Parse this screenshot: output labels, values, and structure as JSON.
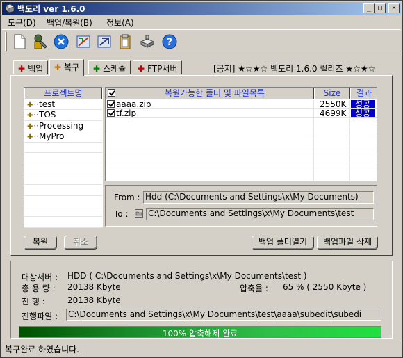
{
  "window": {
    "title": "백도리 ver 1.6.0"
  },
  "titlebar_buttons": {
    "minimize": "_",
    "maximize": "□",
    "close": "×"
  },
  "menu": [
    {
      "label": "도구(D)"
    },
    {
      "label": "백업/복원(B)"
    },
    {
      "label": "정보(A)"
    }
  ],
  "toolbar": {
    "icons": [
      "new-document-icon",
      "settings-wrench-icon",
      "stop-icon",
      "backup-run-icon",
      "restore-icon",
      "clipboard-icon",
      "network-drive-icon",
      "help-icon"
    ]
  },
  "tabs": [
    {
      "label": "백업",
      "dot": "✚",
      "dot_color": "#c00000"
    },
    {
      "label": "복구",
      "dot": "✚",
      "dot_color": "#c07000"
    },
    {
      "label": "스케쥴",
      "dot": "✚",
      "dot_color": "#008000"
    },
    {
      "label": "FTP서버",
      "dot": "✚",
      "dot_color": "#c00000"
    }
  ],
  "notice": "[공지]  ★☆★☆ 백도리 1.6.0 릴리즈 ★☆★☆",
  "project_list": {
    "header": "프로젝트명",
    "items": [
      "test",
      "TOS",
      "Processing",
      "MyPro"
    ]
  },
  "file_table": {
    "headers": {
      "name": "복원가능한 폴더 및 파일목록",
      "size": "Size",
      "result": "결과"
    },
    "rows": [
      {
        "name": "aaaa.zip",
        "size": "2550K",
        "result": "성공"
      },
      {
        "name": "tf.zip",
        "size": "4699K",
        "result": "성공"
      }
    ]
  },
  "from_to": {
    "from_label": "From :",
    "from_value": "Hdd (C:\\Documents and Settings\\x\\My Documents)",
    "to_label": "To :",
    "to_value": "C:\\Documents and Settings\\x\\My Documents\\test"
  },
  "buttons": {
    "restore": "복원",
    "cancel": "취소",
    "open_backup_folder": "백업 폴더열기",
    "delete_backup_file": "백업파일 삭제"
  },
  "info": {
    "target_label": "대상서버 :",
    "target_value": "HDD ( C:\\Documents and Settings\\x\\My Documents\\test )",
    "total_label": "총 용 량 :",
    "total_value": "20138  Kbyte",
    "ratio_label": "압축율 :",
    "ratio_value": "65  % ( 2550 Kbyte )",
    "progress_label": "진    행 :",
    "progress_value": "20138  Kbyte",
    "file_label": "진행파일 :",
    "file_value": "C:\\Documents and Settings\\x\\My Documents\\test\\aaaa\\subedit\\subedi"
  },
  "progress": {
    "percent": 100,
    "text": "100% 압축해제 완료"
  },
  "status": "복구완료 하였습니다."
}
